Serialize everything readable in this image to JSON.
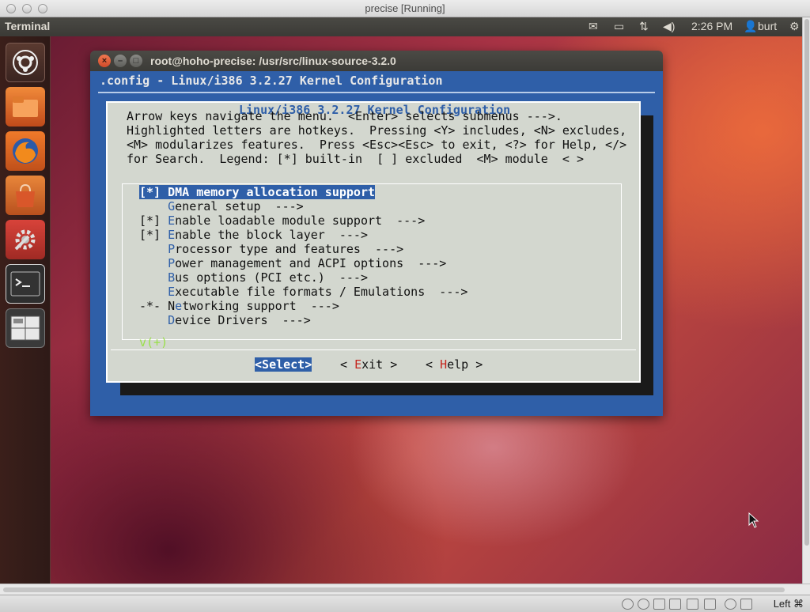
{
  "host_window": {
    "title": "precise [Running]"
  },
  "ubuntu_panel": {
    "app_title": "Terminal",
    "indicators": [
      {
        "icon": "mail-icon"
      },
      {
        "icon": "battery-icon"
      },
      {
        "icon": "network-icon"
      },
      {
        "icon": "volume-icon"
      }
    ],
    "clock": "2:26 PM",
    "user": "burt"
  },
  "launcher": {
    "items": [
      {
        "name": "ubuntu-dash-icon"
      },
      {
        "name": "files-icon"
      },
      {
        "name": "firefox-icon"
      },
      {
        "name": "software-center-icon"
      },
      {
        "name": "system-settings-icon"
      },
      {
        "name": "terminal-icon",
        "active": true
      },
      {
        "name": "workspace-switcher-icon"
      }
    ]
  },
  "terminal": {
    "title": "root@hoho-precise: /usr/src/linux-source-3.2.0",
    "config_header": ".config - Linux/i386 3.2.27 Kernel Configuration",
    "dialog": {
      "title": "Linux/i386 3.2.27 Kernel Configuration",
      "help_lines": [
        "Arrow keys navigate the menu.  <Enter> selects submenus --->.",
        "Highlighted letters are hotkeys.  Pressing <Y> includes, <N> excludes,",
        "<M> modularizes features.  Press <Esc><Esc> to exit, <?> for Help, </>",
        "for Search.  Legend: [*] built-in  [ ] excluded  <M> module  < >"
      ],
      "menu_items": [
        {
          "prefix": "[*] ",
          "hotkey": "D",
          "rest": "MA memory allocation support",
          "suffix": "",
          "selected": true
        },
        {
          "prefix": "    ",
          "hotkey": "G",
          "rest": "eneral setup",
          "suffix": "  --->",
          "selected": false
        },
        {
          "prefix": "[*] ",
          "hotkey": "E",
          "rest": "nable loadable module support",
          "suffix": "  --->",
          "selected": false
        },
        {
          "prefix": "[*] ",
          "hotkey": "E",
          "rest": "nable the block layer",
          "suffix": "  --->",
          "selected": false
        },
        {
          "prefix": "    ",
          "hotkey": "P",
          "rest": "rocessor type and features",
          "suffix": "  --->",
          "selected": false
        },
        {
          "prefix": "    ",
          "hotkey": "P",
          "rest": "ower management and ACPI options",
          "suffix": "  --->",
          "selected": false
        },
        {
          "prefix": "    ",
          "hotkey": "B",
          "rest": "us options (PCI etc.)",
          "suffix": "  --->",
          "selected": false
        },
        {
          "prefix": "    ",
          "hotkey": "E",
          "rest": "xecutable file formats / Emulations",
          "suffix": "  --->",
          "selected": false
        },
        {
          "prefix": "-*- ",
          "hotkey": "N",
          "pre_hotkey": "",
          "rest": "etworking support",
          "suffix": "  --->",
          "selected": false,
          "hotkey_index": 1
        },
        {
          "prefix": "    ",
          "hotkey": "D",
          "rest": "evice Drivers",
          "suffix": "  --->",
          "selected": false
        }
      ],
      "more_indicator": "v(+)",
      "buttons": {
        "select": {
          "open": "<",
          "hotkey": "S",
          "rest": "elect",
          "close": ">"
        },
        "exit": {
          "open": "< ",
          "hotkey": "E",
          "rest": "xit",
          "close": " >"
        },
        "help": {
          "open": "< ",
          "hotkey": "H",
          "rest": "elp",
          "close": " >"
        }
      }
    }
  },
  "vbox_status": {
    "host_key": "Left ⌘"
  },
  "colors": {
    "terminal_bg": "#2f5fa8",
    "dialog_bg": "#d3d7cf",
    "hotkey_blue": "#2f5fa8",
    "hotkey_red": "#c4261e",
    "more_green": "#9ae04a"
  }
}
